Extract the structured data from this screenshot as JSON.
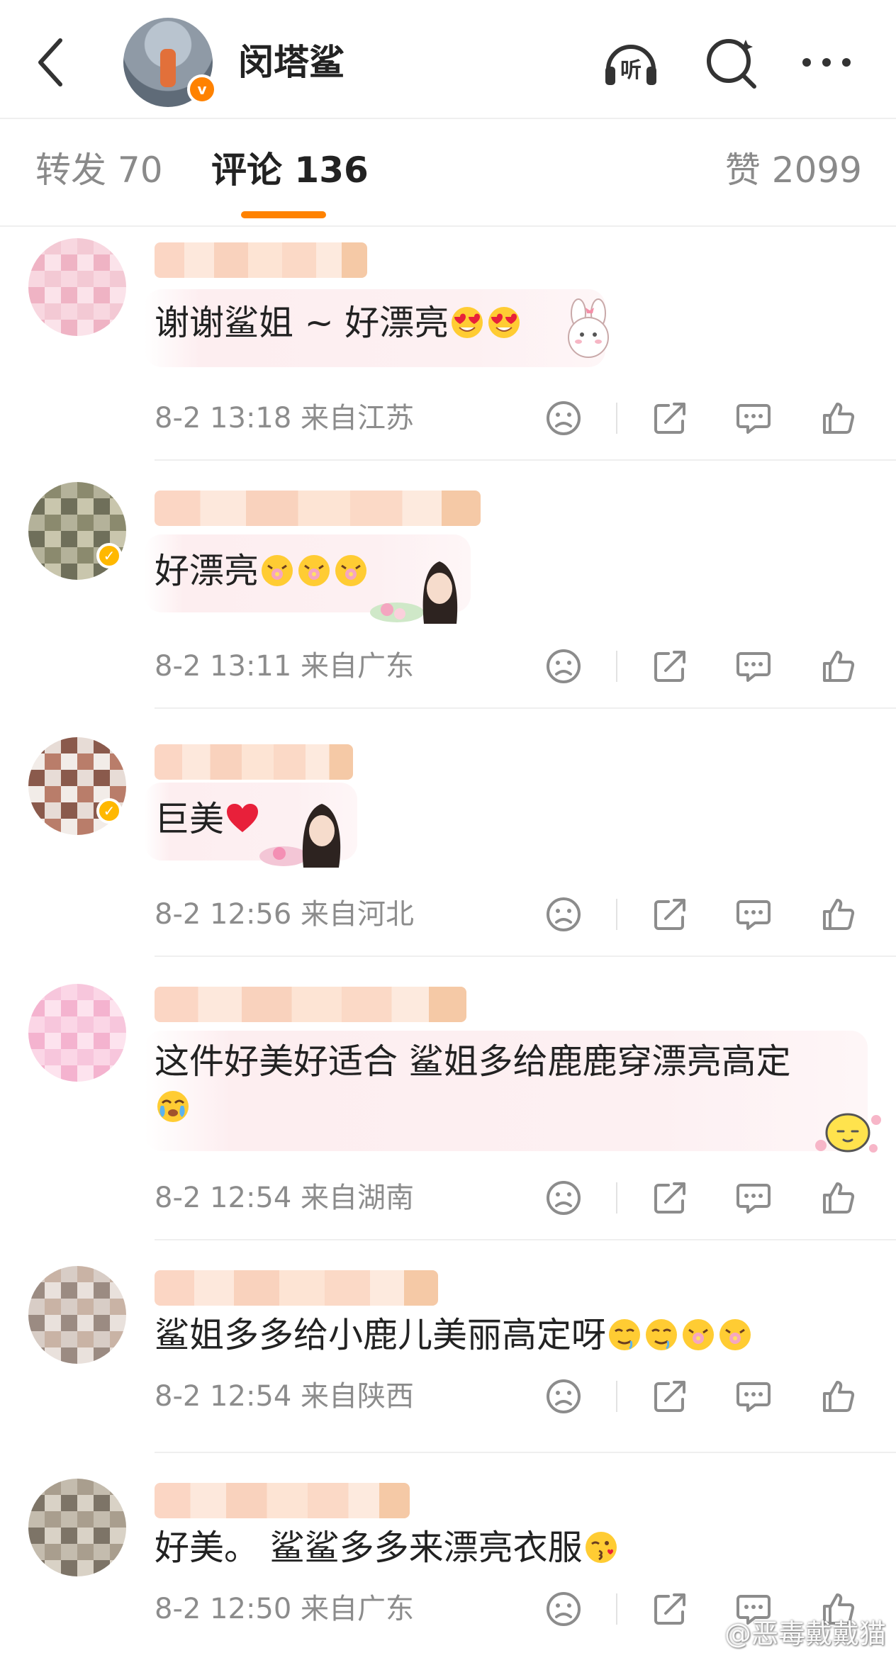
{
  "header": {
    "title": "闵塔鲨",
    "listen_label": "听",
    "avatar_badge": "v"
  },
  "tabs": [
    {
      "label": "转发 70",
      "active": false
    },
    {
      "label": "评论 136",
      "active": true
    },
    {
      "label": "赞 2099",
      "active": false
    }
  ],
  "comments": [
    {
      "text": "谢谢鲨姐 ~ 好漂亮",
      "emojis": [
        "heart-eyes-face",
        "heart-eyes-face"
      ],
      "time": "8-2 13:18",
      "location": "来自江苏",
      "sticker": "bunny-sticker"
    },
    {
      "text": "好漂亮",
      "emojis": [
        "flower-face",
        "flower-face",
        "flower-face"
      ],
      "time": "8-2 13:11",
      "location": "来自广东",
      "sticker": "portrait-sticker"
    },
    {
      "text": "巨美",
      "emojis": [
        "red-heart"
      ],
      "time": "8-2 12:56",
      "location": "来自河北",
      "sticker": "portrait-sticker"
    },
    {
      "text": "这件好美好适合 鲨姐多给鹿鹿穿漂亮高定",
      "emojis": [
        "teary-face"
      ],
      "time": "8-2 12:54",
      "location": "来自湖南",
      "sticker": "lemon-sticker"
    },
    {
      "text": "鲨姐多多给小鹿儿美丽高定呀",
      "emojis": [
        "drool-face",
        "drool-face",
        "flower-face",
        "flower-face"
      ],
      "time": "8-2 12:54",
      "location": "来自陕西",
      "sticker": ""
    },
    {
      "text": "好美。 鲨鲨多多来漂亮衣服",
      "emojis": [
        "kiss-face"
      ],
      "time": "8-2 12:50",
      "location": "来自广东",
      "sticker": ""
    }
  ],
  "actions": {
    "dislike": "frown-icon",
    "share": "share-icon",
    "reply": "comment-icon",
    "like": "thumbs-up-icon"
  },
  "watermark": "@恶毒戴戴猫",
  "colors": {
    "accent": "#ff8200",
    "meta": "#8c8c8c"
  }
}
